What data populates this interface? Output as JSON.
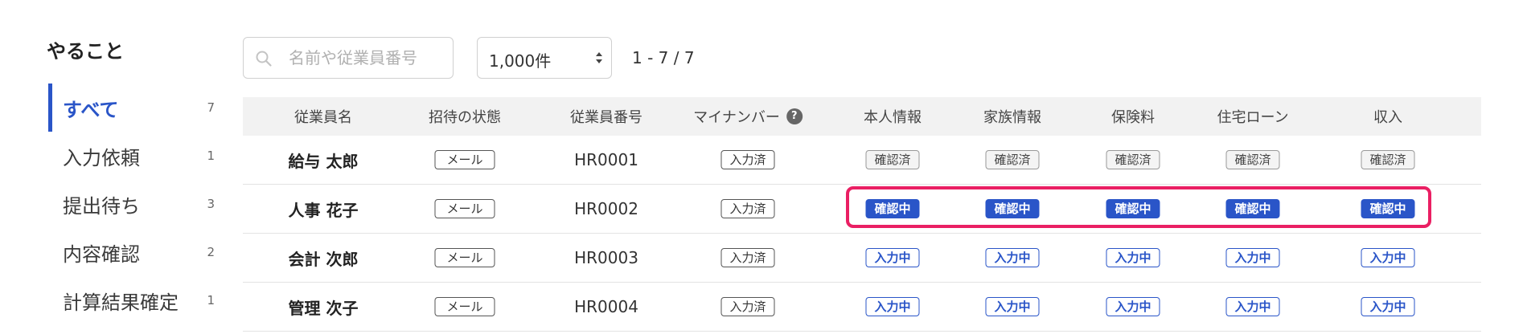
{
  "sidebar": {
    "title": "やること",
    "items": [
      {
        "label": "すべて",
        "count": "7"
      },
      {
        "label": "入力依頼",
        "count": "1"
      },
      {
        "label": "提出待ち",
        "count": "3"
      },
      {
        "label": "内容確認",
        "count": "2"
      },
      {
        "label": "計算結果確定",
        "count": "1"
      }
    ],
    "active_index": 0
  },
  "toolbar": {
    "search_placeholder": "名前や従業員番号",
    "search_value": "",
    "per_page": "1,000件",
    "range": "1 - 7 / 7"
  },
  "table": {
    "columns": {
      "name": "従業員名",
      "invite": "招待の状態",
      "empno": "従業員番号",
      "mynumber": "マイナンバー",
      "self": "本人情報",
      "family": "家族情報",
      "insurance": "保険料",
      "loan": "住宅ローン",
      "income": "収入"
    },
    "help_glyph": "?",
    "rows": [
      {
        "name": "給与 太郎",
        "invite": "メール",
        "empno": "HR0001",
        "mynumber": "入力済",
        "self": "確認済",
        "family": "確認済",
        "insurance": "確認済",
        "loan": "確認済",
        "income": "確認済"
      },
      {
        "name": "人事 花子",
        "invite": "メール",
        "empno": "HR0002",
        "mynumber": "入力済",
        "self": "確認中",
        "family": "確認中",
        "insurance": "確認中",
        "loan": "確認中",
        "income": "確認中"
      },
      {
        "name": "会計 次郎",
        "invite": "メール",
        "empno": "HR0003",
        "mynumber": "入力済",
        "self": "入力中",
        "family": "入力中",
        "insurance": "入力中",
        "loan": "入力中",
        "income": "入力中"
      },
      {
        "name": "管理 次子",
        "invite": "メール",
        "empno": "HR0004",
        "mynumber": "入力済",
        "self": "入力中",
        "family": "入力中",
        "insurance": "入力中",
        "loan": "入力中",
        "income": "入力中"
      }
    ]
  },
  "colors": {
    "accent": "#2a55c8",
    "highlight": "#ea1f63"
  },
  "icons": {
    "search": "search-icon",
    "select": "select-arrows-icon",
    "help": "help-icon"
  }
}
